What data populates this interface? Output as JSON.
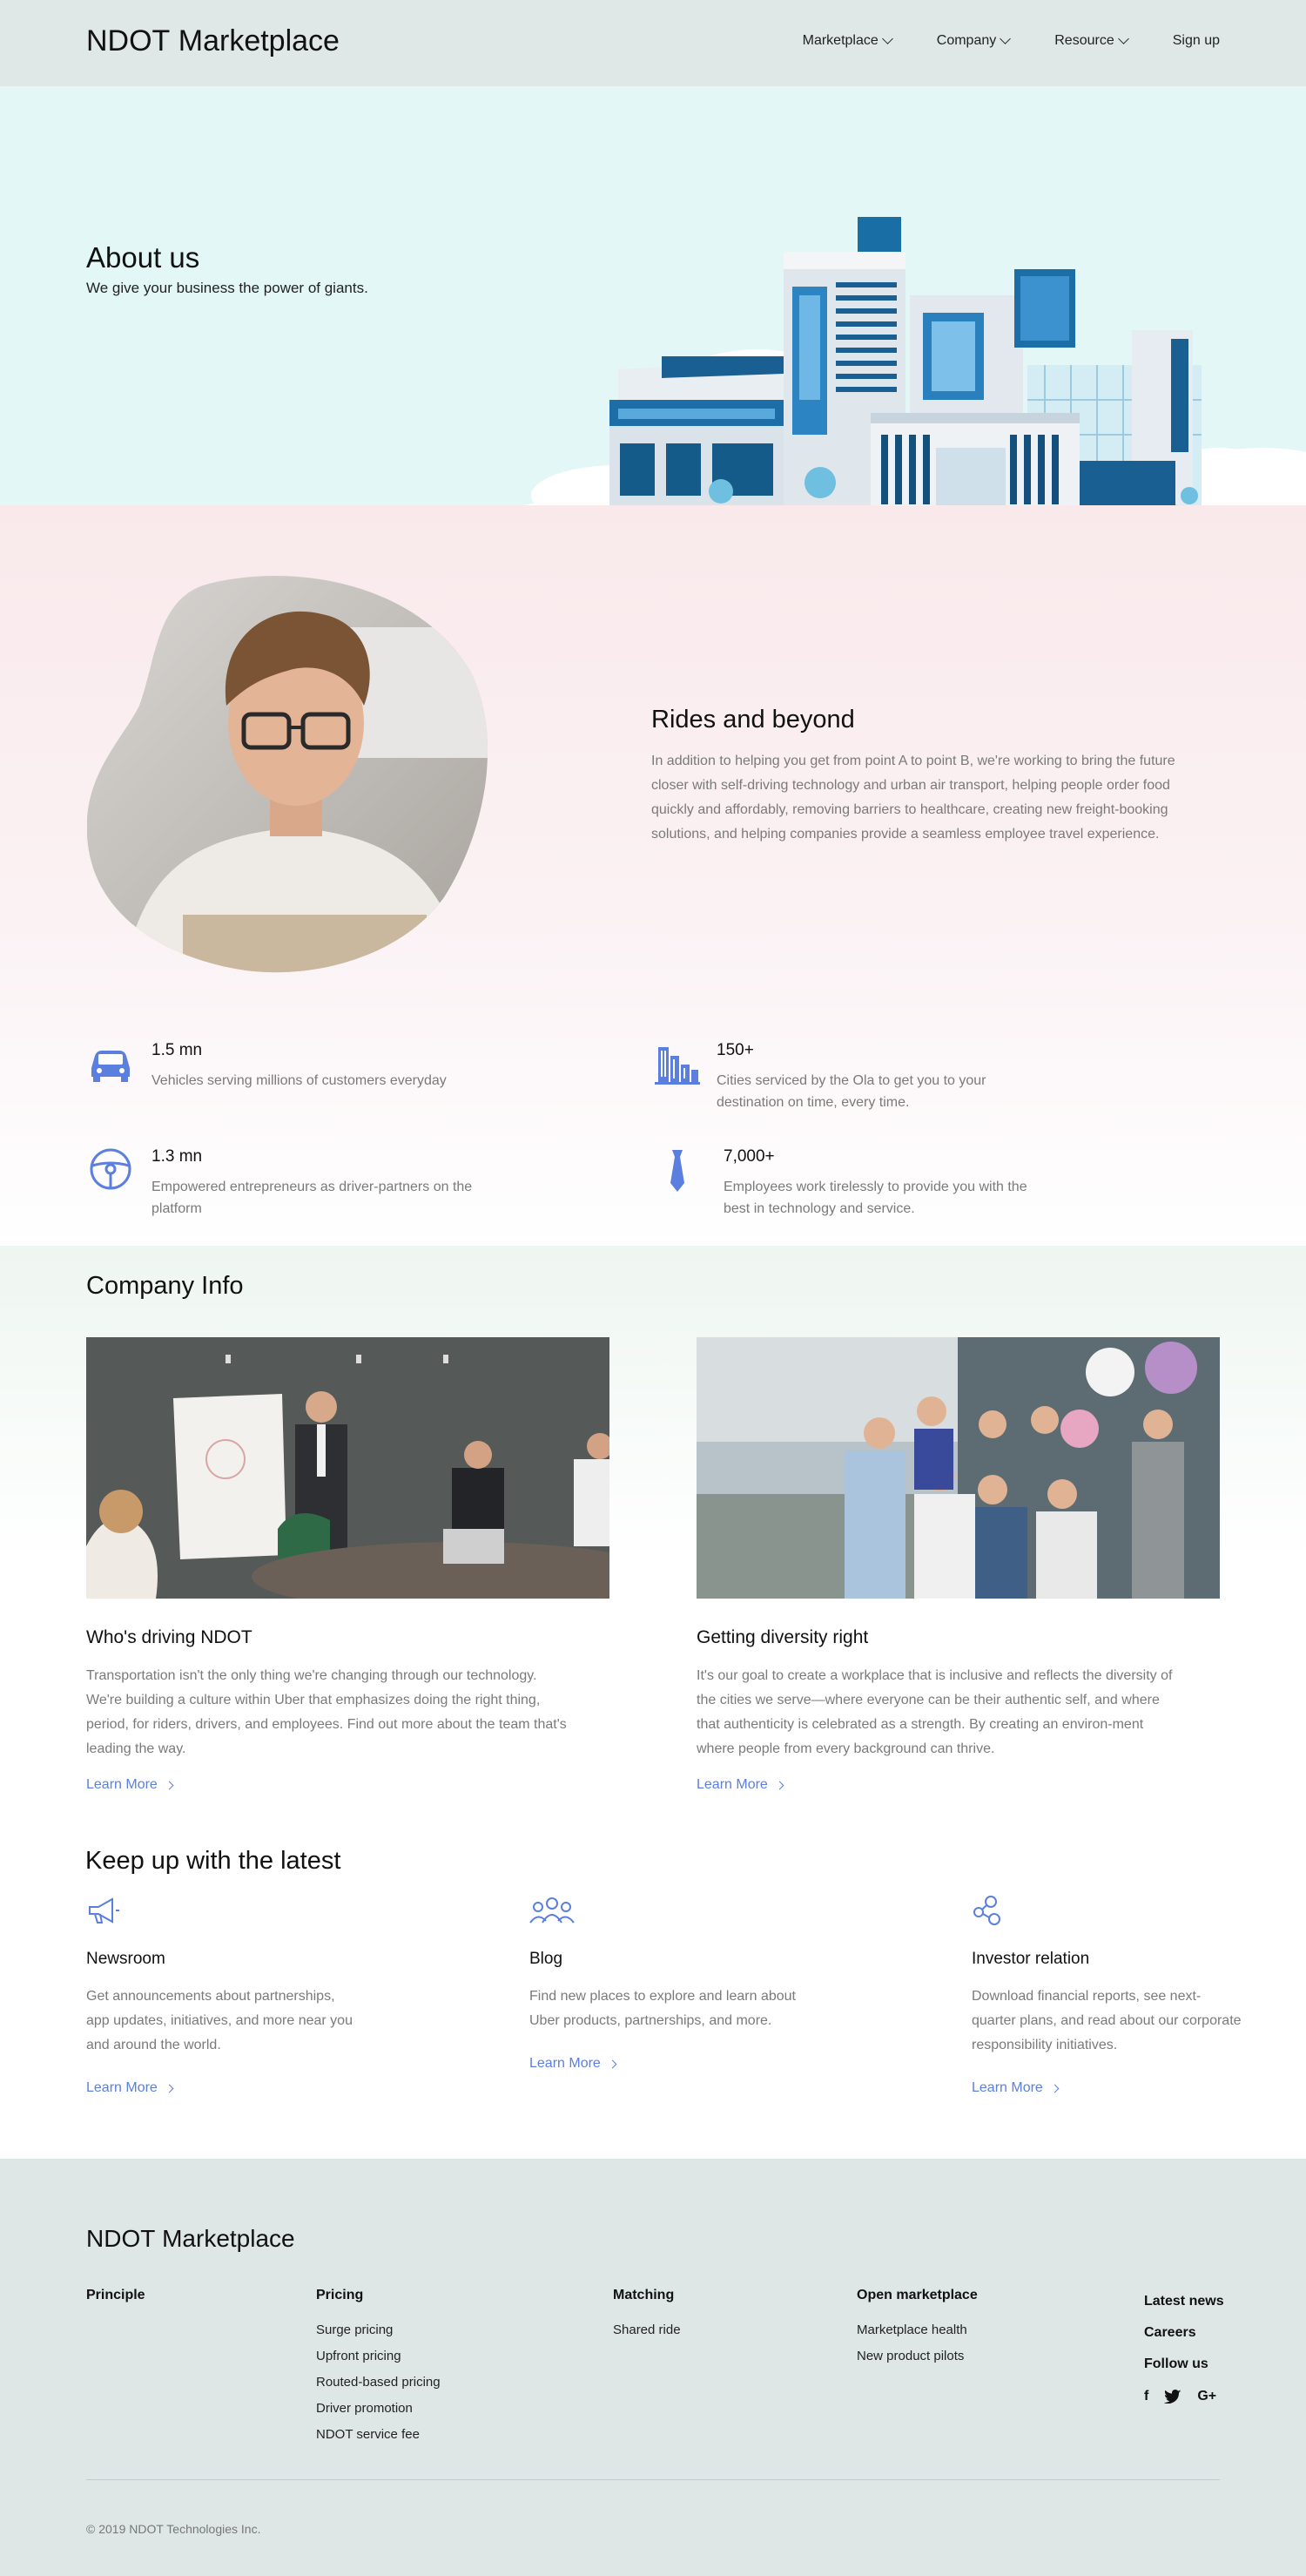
{
  "header": {
    "logo_bold": "NDOT",
    "logo_light": " Marketplace",
    "nav": [
      {
        "label": "Marketplace",
        "has_dropdown": true
      },
      {
        "label": "Company",
        "has_dropdown": true
      },
      {
        "label": "Resource",
        "has_dropdown": true
      },
      {
        "label": "Sign up",
        "has_dropdown": false
      }
    ]
  },
  "hero": {
    "title": "About us",
    "subtitle": "We give your business the power of giants."
  },
  "rides": {
    "title": "Rides and beyond",
    "text": "In addition to helping you get from point A to point B, we're working to bring the future closer with self-driving technology and urban air transport, helping people order food quickly and affordably, removing barriers to healthcare, creating new freight-booking solutions, and helping companies provide a seamless employee travel experience.",
    "stats": [
      {
        "icon": "car-icon",
        "value": "1.5 mn",
        "desc": "Vehicles serving millions of customers everyday"
      },
      {
        "icon": "city-buildings-icon",
        "value": "150+",
        "desc": "Cities serviced by the Ola to get you to your destination on time, every time."
      },
      {
        "icon": "steering-wheel-icon",
        "value": "1.3 mn",
        "desc": "Empowered entrepreneurs as driver-partners on the platform"
      },
      {
        "icon": "necktie-icon",
        "value": "7,000+",
        "desc": "Employees work tirelessly to provide you with the best in technology and service."
      }
    ]
  },
  "company": {
    "title": "Company Info",
    "cards": [
      {
        "title": "Who's driving NDOT",
        "text": "Transportation isn't the only thing we're changing through our technology. We're building a culture within Uber that emphasizes doing the right thing, period, for riders, drivers, and employees. Find out more about the team that's leading the way.",
        "link": "Learn More"
      },
      {
        "title": "Getting diversity right",
        "text": "It's our goal to create a workplace that is inclusive and reflects the diversity of the cities we serve—where everyone can be their authentic self, and where that authenticity is celebrated as a strength. By creating an environ-ment where people from every background can thrive.",
        "link": "Learn More"
      }
    ]
  },
  "latest": {
    "title": "Keep up with the latest",
    "items": [
      {
        "icon": "megaphone-icon",
        "title": "Newsroom",
        "text": "Get announcements about partnerships, app updates, initiatives, and more near you and around the world.",
        "link": "Learn More"
      },
      {
        "icon": "people-group-icon",
        "title": "Blog",
        "text": "Find new places to explore and learn about Uber products, partnerships, and more.",
        "link": "Learn More"
      },
      {
        "icon": "network-icon",
        "title": "Investor relation",
        "text": "Download financial reports, see next-quarter plans, and read about our corporate responsibility initiatives.",
        "link": "Learn More"
      }
    ]
  },
  "footer": {
    "logo_bold": "NDOT",
    "logo_light": " Marketplace",
    "columns": [
      {
        "head": "Principle",
        "links": []
      },
      {
        "head": "Pricing",
        "links": [
          "Surge pricing",
          "Upfront pricing",
          "Routed-based pricing",
          "Driver promotion",
          "NDOT service fee"
        ]
      },
      {
        "head": "Matching",
        "links": [
          "Shared ride"
        ]
      },
      {
        "head": "Open marketplace",
        "links": [
          "Marketplace health",
          "New product pilots"
        ]
      }
    ],
    "right": [
      "Latest news",
      "Careers",
      "Follow us"
    ],
    "socials": {
      "facebook": "f",
      "twitter": "t",
      "google": "G+"
    },
    "copyright": "© 2019 NDOT Technologies Inc."
  },
  "colors": {
    "accent": "#5b7fde",
    "header_bg": "#e0e7e7",
    "hero_bg": "#e2f7f6",
    "footer_bg": "#dfe6e6"
  }
}
